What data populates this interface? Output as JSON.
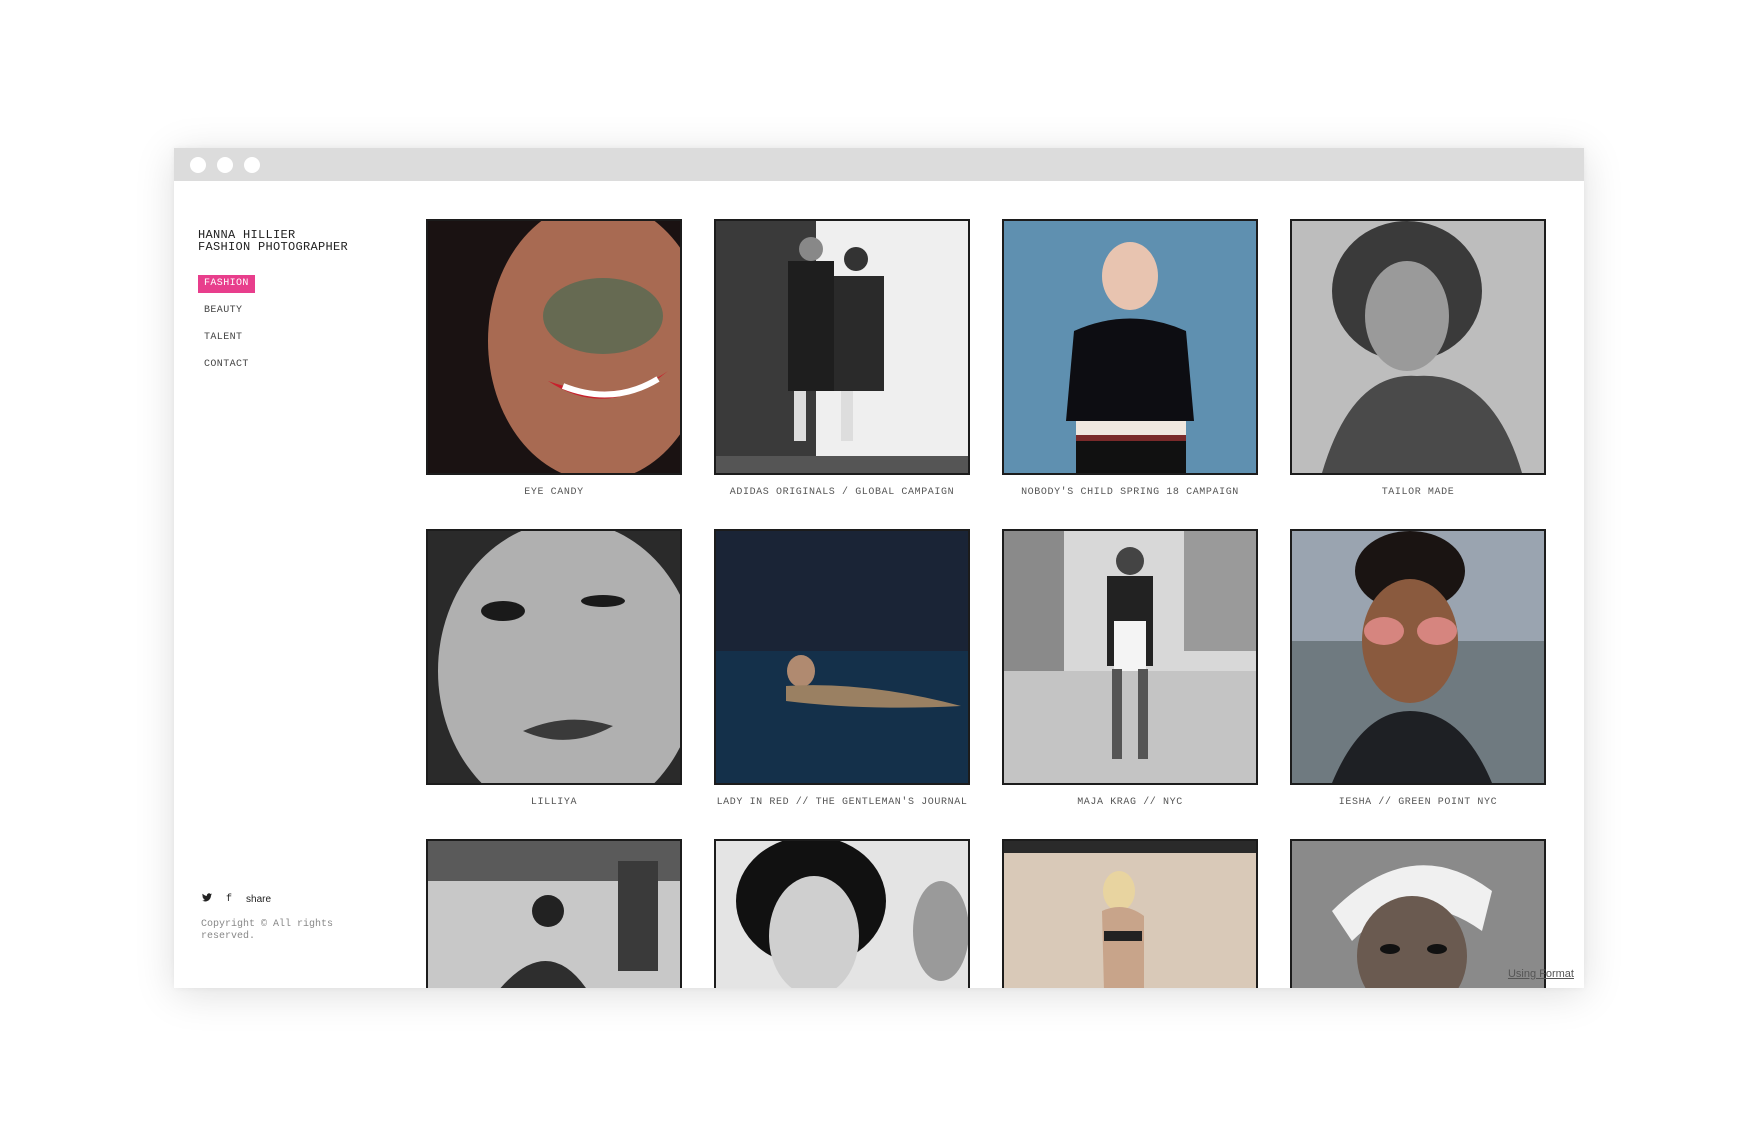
{
  "brand": {
    "name": "HANNA HILLIER",
    "role": "FASHION PHOTOGRAPHER"
  },
  "nav": [
    {
      "label": "FASHION",
      "active": true
    },
    {
      "label": "BEAUTY",
      "active": false
    },
    {
      "label": "TALENT",
      "active": false
    },
    {
      "label": "CONTACT",
      "active": false
    }
  ],
  "social": {
    "twitter": "🐦",
    "facebook": "f",
    "share": "share"
  },
  "copyright": "Copyright © All rights reserved.",
  "footer_link": "Using Format",
  "colors": {
    "accent": "#e83e8c",
    "titlebar": "#dcdcdc"
  },
  "gallery": [
    {
      "caption": "EYE CANDY"
    },
    {
      "caption": "ADIDAS ORIGINALS / GLOBAL CAMPAIGN"
    },
    {
      "caption": "NOBODY'S CHILD SPRING 18 CAMPAIGN"
    },
    {
      "caption": "TAILOR MADE"
    },
    {
      "caption": "LILLIYA"
    },
    {
      "caption": "LADY IN RED // THE GENTLEMAN'S JOURNAL"
    },
    {
      "caption": "MAJA KRAG // NYC"
    },
    {
      "caption": "IESHA // GREEN POINT NYC"
    },
    {
      "caption": ""
    },
    {
      "caption": ""
    },
    {
      "caption": ""
    },
    {
      "caption": ""
    }
  ]
}
